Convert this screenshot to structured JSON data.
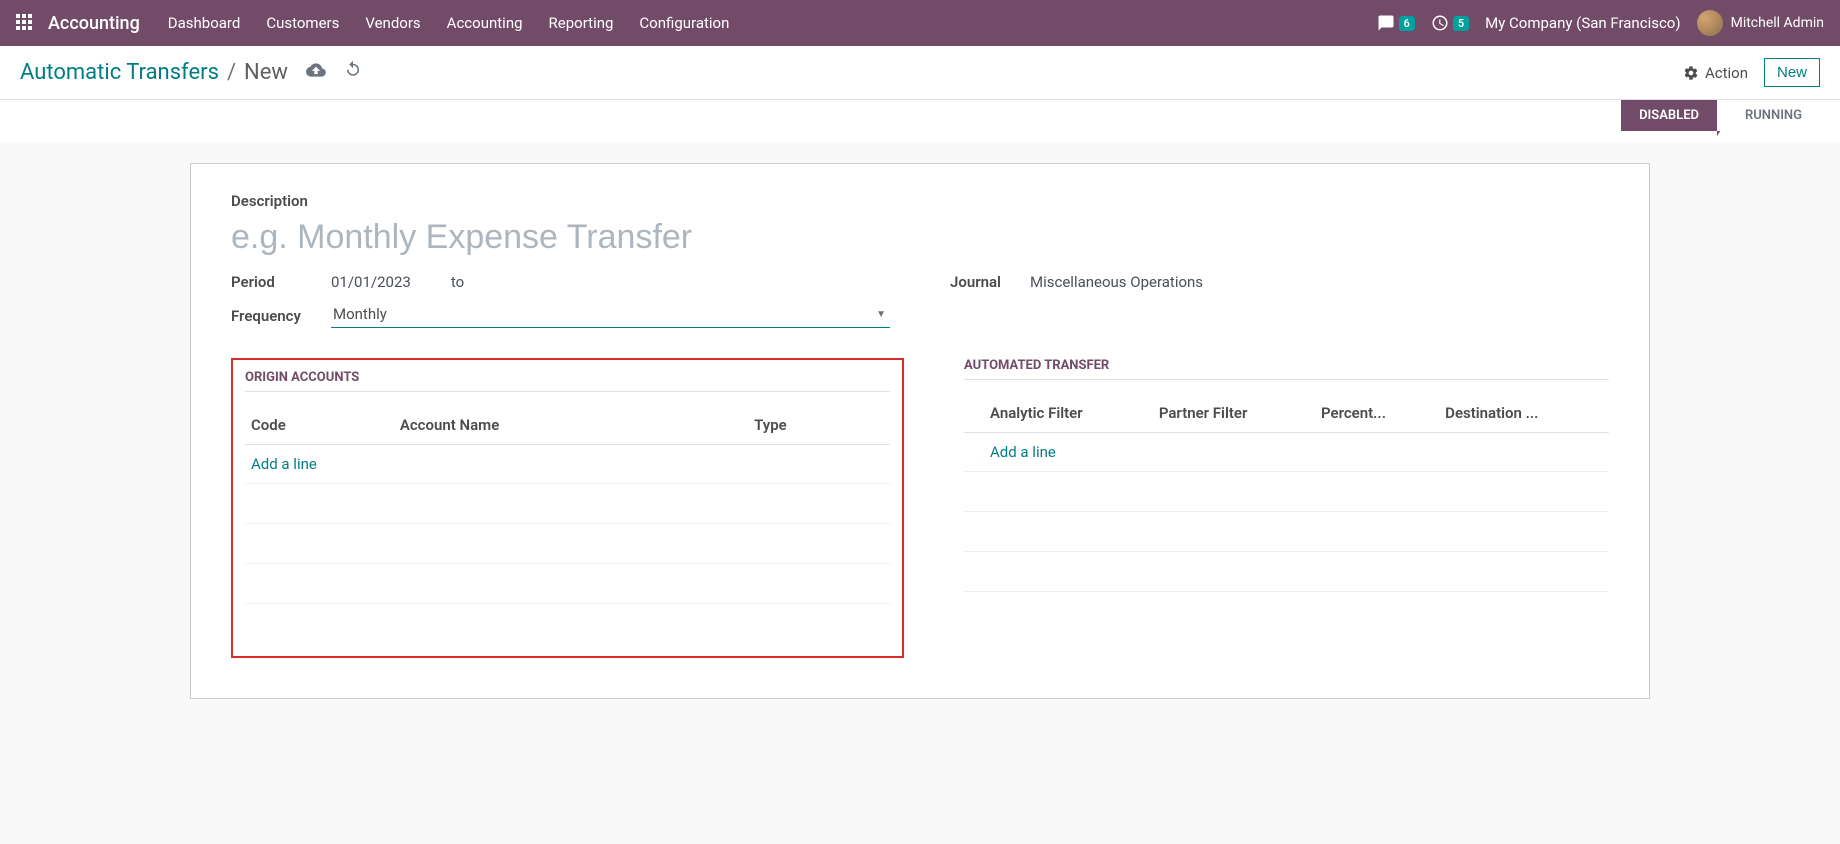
{
  "nav": {
    "brand": "Accounting",
    "links": [
      "Dashboard",
      "Customers",
      "Vendors",
      "Accounting",
      "Reporting",
      "Configuration"
    ],
    "messages_count": "6",
    "activities_count": "5",
    "company": "My Company (San Francisco)",
    "user": "Mitchell Admin"
  },
  "controlbar": {
    "breadcrumb_root": "Automatic Transfers",
    "breadcrumb_current": "New",
    "action_label": "Action",
    "new_label": "New"
  },
  "status": {
    "disabled": "DISABLED",
    "running": "RUNNING"
  },
  "form": {
    "description_label": "Description",
    "description_placeholder": "e.g. Monthly Expense Transfer",
    "period_label": "Period",
    "period_start": "01/01/2023",
    "period_to": "to",
    "frequency_label": "Frequency",
    "frequency_value": "Monthly",
    "journal_label": "Journal",
    "journal_value": "Miscellaneous Operations"
  },
  "origin": {
    "title": "ORIGIN ACCOUNTS",
    "columns": {
      "code": "Code",
      "name": "Account Name",
      "type": "Type"
    },
    "add_line": "Add a line"
  },
  "transfer": {
    "title": "AUTOMATED TRANSFER",
    "columns": {
      "analytic": "Analytic Filter",
      "partner": "Partner Filter",
      "percent": "Percent...",
      "dest": "Destination ..."
    },
    "add_line": "Add a line"
  }
}
